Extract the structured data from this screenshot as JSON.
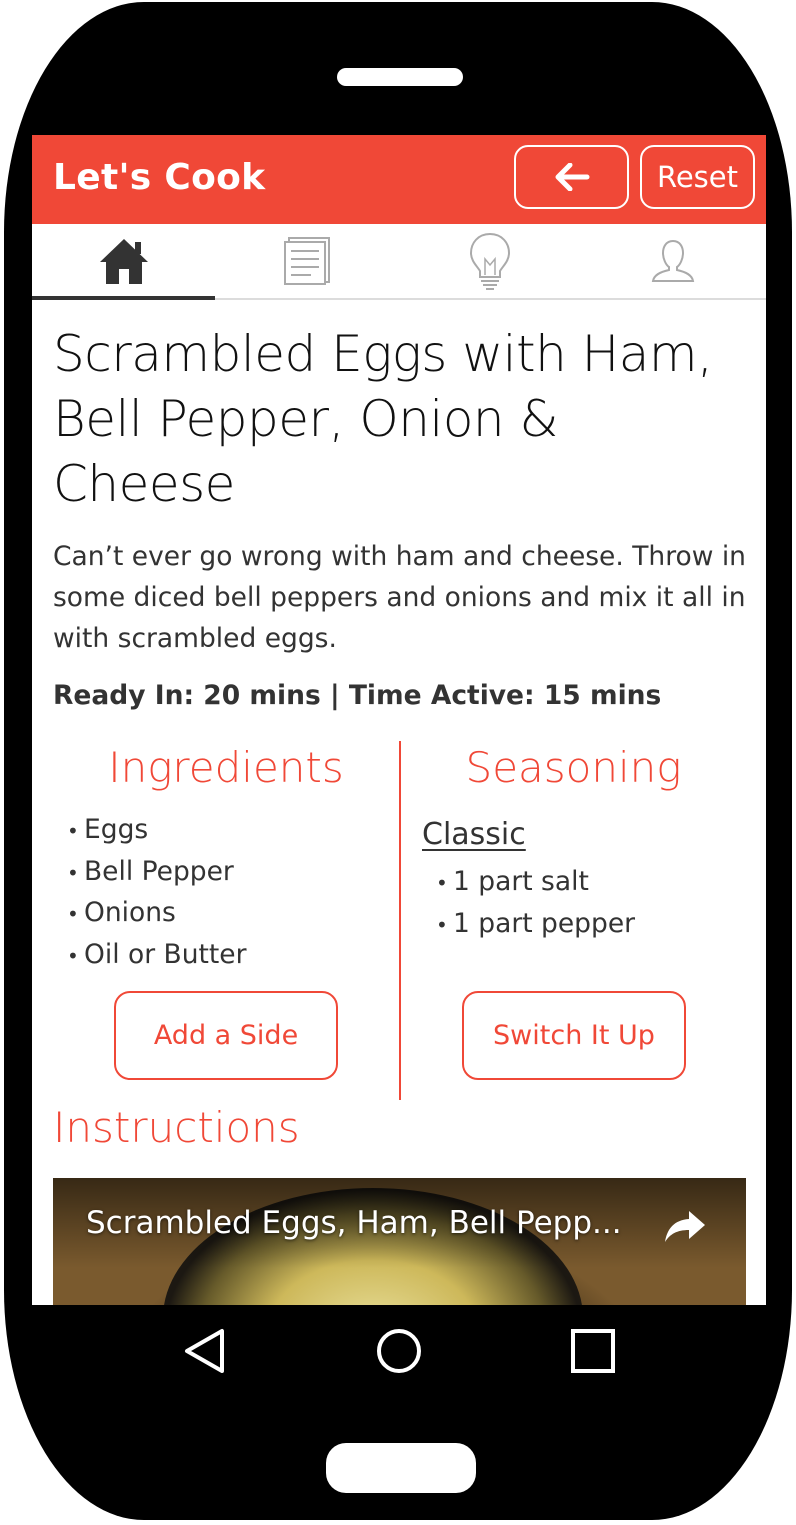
{
  "header": {
    "title": "Let's Cook",
    "back_icon": "arrow-left-icon",
    "reset_label": "Reset"
  },
  "tabs": [
    {
      "icon": "home-icon",
      "active": true
    },
    {
      "icon": "document-icon",
      "active": false
    },
    {
      "icon": "lightbulb-icon",
      "active": false
    },
    {
      "icon": "user-icon",
      "active": false
    }
  ],
  "recipe": {
    "title": "Scrambled Eggs with Ham, Bell Pepper, Onion & Cheese",
    "description": "Can’t ever go wrong with ham and cheese. Throw in some diced bell peppers and onions and mix it all in with scrambled eggs.",
    "times": "Ready In: 20 mins | Time Active: 15 mins"
  },
  "ingredients": {
    "heading": "Ingredients",
    "items": [
      "Eggs",
      "Bell Pepper",
      "Onions",
      "Oil or Butter"
    ],
    "button_label": "Add a Side"
  },
  "seasoning": {
    "heading": "Seasoning",
    "style_label": "Classic",
    "items": [
      "1 part salt",
      "1 part pepper"
    ],
    "button_label": "Switch It Up"
  },
  "instructions": {
    "heading": "Instructions",
    "video_title": "Scrambled Eggs, Ham, Bell Pepp..."
  },
  "nav": {
    "back_icon": "triangle-back-icon",
    "home_icon": "circle-home-icon",
    "recents_icon": "square-recents-icon"
  },
  "colors": {
    "accent": "#f04837",
    "text": "#333333",
    "phone_body": "#000000"
  }
}
